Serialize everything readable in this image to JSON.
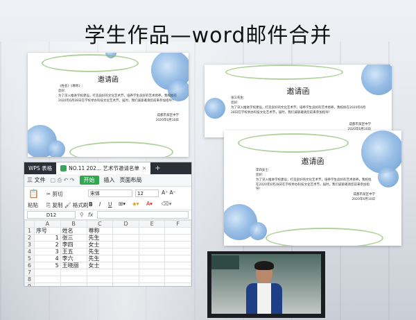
{
  "slide": {
    "title": "学生作品—word邮件合并"
  },
  "invitation_cards": [
    {
      "title": "邀请函",
      "recipient": "《姓名》《尊称》:",
      "greeting": "您好:",
      "body": "为了深入推进学校建设，打造良好的文化艺术节，培养学生良好的艺术修养。我校拟在2020年6月28日在学校举办科技文化艺术节，届时，我们诚挚邀请您前来参加指导！",
      "school": "成都市某区中学",
      "date": "2020年6月10日"
    },
    {
      "title": "邀请函",
      "recipient": "张三先生:",
      "greeting": "您好:",
      "body": "为了深入推进学校建设，打造良好的文化艺术节，培养学生良好的艺术修养。我校拟在2020年6月28日在学校举办科技文化艺术节，届时，我们诚挚邀请您前来参加指导！",
      "school": "成都市某区中学",
      "date": "2020年6月10日"
    },
    {
      "title": "邀请函",
      "recipient": "李四女士:",
      "greeting": "您好:",
      "body": "为了深入推进学校建设，打造良好的文化艺术节，培养学生良好的艺术修养。我校拟在2020年6月28日在学校举办科技文化艺术节，届时，我们诚挚邀请您前来参加指导！",
      "school": "成都市某区中学",
      "date": "2020年6月10日"
    }
  ],
  "spreadsheet": {
    "app_tab": "WPS 表格",
    "doc_tab": "NO.11  202...  艺术节邀请名单",
    "menu": [
      "三 文件",
      "开始",
      "插入",
      "页面布局"
    ],
    "toolbar": {
      "paste": "粘贴",
      "cut": "剪切",
      "copy": "复制",
      "format_painter": "格式刷",
      "font_name": "宋体",
      "font_size": "12"
    },
    "name_box": "D12",
    "fx": "fx",
    "columns": [
      "A",
      "B",
      "C",
      "D",
      "E",
      "F"
    ],
    "rows": [
      {
        "n": "1",
        "a": "序号",
        "b": "姓名",
        "c": "尊称"
      },
      {
        "n": "2",
        "a": "1",
        "b": "张三",
        "c": "先生"
      },
      {
        "n": "3",
        "a": "2",
        "b": "李四",
        "c": "女士"
      },
      {
        "n": "4",
        "a": "3",
        "b": "王五",
        "c": "先生"
      },
      {
        "n": "5",
        "a": "4",
        "b": "李六",
        "c": "先生"
      },
      {
        "n": "6",
        "a": "5",
        "b": "王晓丽",
        "c": "女士"
      },
      {
        "n": "7",
        "a": "",
        "b": "",
        "c": ""
      },
      {
        "n": "8",
        "a": "",
        "b": "",
        "c": ""
      },
      {
        "n": "9",
        "a": "",
        "b": "",
        "c": ""
      }
    ]
  },
  "colors": {
    "wps_green": "#2fa84f",
    "tab_dark": "#2b2f36",
    "flower_blue": "#5f93c9"
  }
}
